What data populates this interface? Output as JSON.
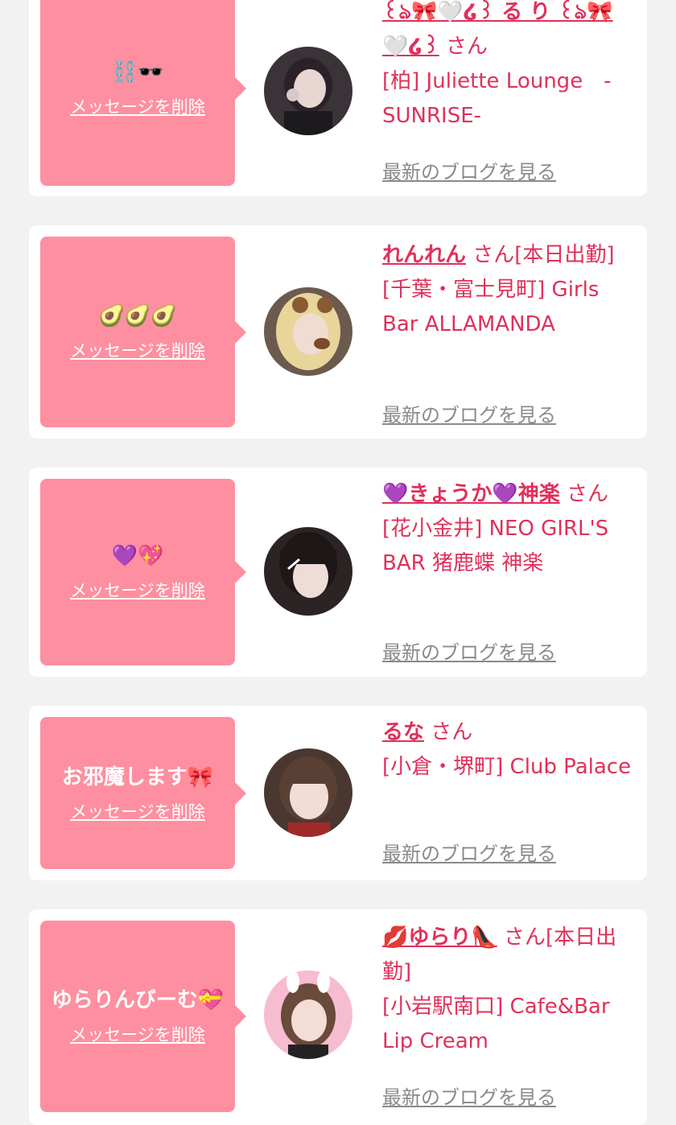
{
  "delete_label": "メッセージを削除",
  "blog_label": "最新のブログを見る",
  "colors": {
    "accent": "#e0305a",
    "bubble": "#fe8fa0",
    "card_bg": "#ffffff",
    "page_bg": "#f2f2f2",
    "link_gray": "#8a8a8a"
  },
  "cards": [
    {
      "message": "⛓️🕶️",
      "name": "꒰ঌ🎀🤍໒꒱ る り ꒰ঌ🎀🤍໒꒱",
      "suffix": "さん",
      "shop": "[柏] Juliette Lounge　-SUNRISE-"
    },
    {
      "message": "🥑🥑🥑",
      "name": "れんれん",
      "suffix": "さん[本日出勤]",
      "shop": "[千葉・富士見町] Girls Bar ALLAMANDA"
    },
    {
      "message": "💜💖",
      "name": "💜きょうか💜神楽",
      "suffix": "さん",
      "shop": "[花小金井] NEO GIRL'S BAR 猪鹿蝶 神楽"
    },
    {
      "message": "お邪魔します🎀",
      "name": "るな",
      "suffix": "さん",
      "shop": "[小倉・堺町] Club Palace"
    },
    {
      "message": "ゆらりんびーむ💝",
      "name": "💋ゆらり👠",
      "suffix": "さん[本日出勤]",
      "shop": "[小岩駅南口] Cafe&Bar Lip Cream"
    }
  ]
}
